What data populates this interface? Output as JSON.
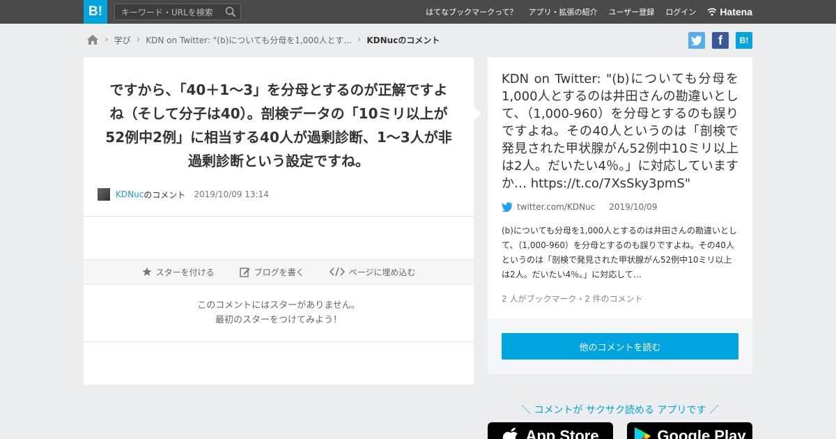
{
  "header": {
    "logo": "B!",
    "search_placeholder": "キーワード・URLを検索",
    "nav": [
      "はてなブックマークって？",
      "アプリ・拡張の紹介",
      "ユーザー登録",
      "ログイン"
    ],
    "hatena": "Hatena"
  },
  "breadcrumb": {
    "category": "学び",
    "entry": "KDN on Twitter: \"(b)についても分母を1,000人とす...",
    "current": "KDNucのコメント"
  },
  "share": {
    "facebook": "f",
    "hatebu": "B!"
  },
  "comment": {
    "text": "ですから、「40＋1～3」を分母とするのが正解ですよね（そして分子は40）。剖検データの「10ミリ以上が52例中2例」に相当する40人が過剰診断、1～3人が非過剰診断という設定ですね。",
    "user": "KDNuc",
    "user_suffix": "のコメント",
    "date": "2019/10/09 13:14"
  },
  "actions": {
    "star": "スターを付ける",
    "blog": "ブログを書く",
    "embed": "ページに埋め込む"
  },
  "stars": {
    "line1": "このコメントにはスターがありません。",
    "line2": "最初のスターをつけてみよう！"
  },
  "entry": {
    "title": "KDN on Twitter: \"(b)についても分母を1,000人とするのは井田さんの勘違いとして、（1,000-960）を分母とするのも誤りですよね。その40人というのは「剖検で発見された甲状腺がん52例中10ミリ以上は2人。だいたい4％。」に対応していますか… https://t.co/7XsSky3pmS\"",
    "domain": "twitter.com/KDNuc",
    "date": "2019/10/09",
    "excerpt": "(b)についても分母を1,000人とするのは井田さんの勘違いとして、（1,000-960）を分母とするのも誤りですよね。その40人というのは「剖検で発見された甲状腺がん52例中10ミリ以上は2人。だいたい4％。」に対応して…",
    "counts": "2 人がブックマーク・2 件のコメント",
    "read_more": "他のコメントを読む"
  },
  "promo": {
    "text": "＼ コメントが サクサク読める アプリです ／",
    "app_store": "App Store",
    "google_play": "Google Play"
  }
}
